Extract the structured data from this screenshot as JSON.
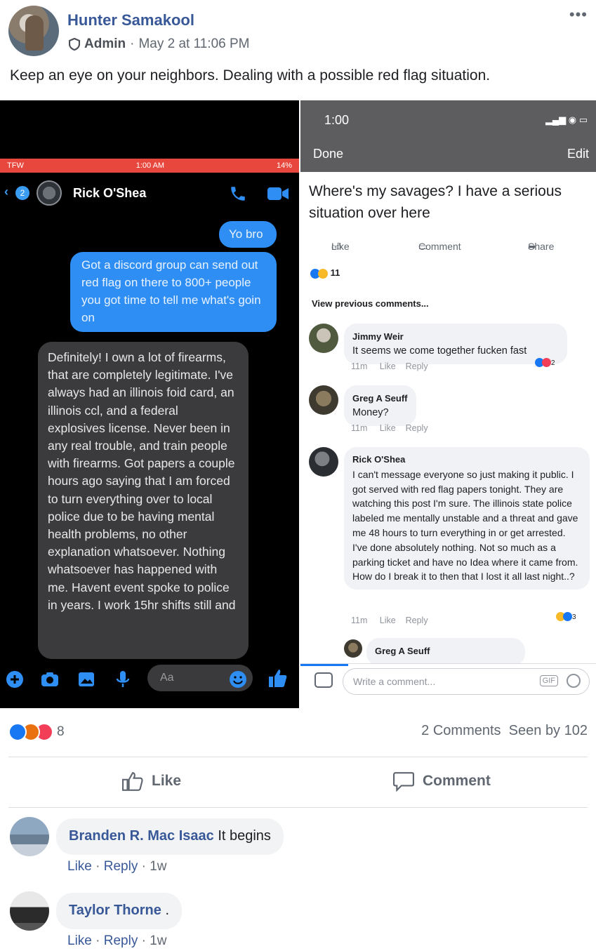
{
  "post": {
    "author": "Hunter Samakool",
    "role": "Admin",
    "separator": "·",
    "timestamp": "May 2 at 11:06 PM",
    "more": "•••",
    "text": "Keep an eye on your neighbors. Dealing with a possible red flag situation."
  },
  "left_screenshot": {
    "status": {
      "carrier": "TFW",
      "time": "1:00 AM",
      "battery": "14%"
    },
    "back_count": "2",
    "contact_name": "Rick O'Shea",
    "messages": [
      {
        "from": "me",
        "text": "Yo bro"
      },
      {
        "from": "me",
        "text": "Got a discord group can send out red flag on there to 800+ people you got time to tell me what's goin on"
      },
      {
        "from": "them",
        "text": "Definitely! I own a lot of firearms, that are completely legitimate. I've always had an illinois foid card, an illinois ccl, and a federal explosives license. Never been in any real trouble, and train people with firearms. Got papers a couple hours ago saying that I am forced to turn everything over to local police due to be having mental health problems, no other explanation whatsoever. Nothing whatsoever has happened with me. Havent event spoke to police in years. I work 15hr shifts still and"
      }
    ],
    "composer_placeholder": "Aa"
  },
  "right_screenshot": {
    "time": "1:00",
    "done": "Done",
    "edit": "Edit",
    "post_text": "Where's my savages? I have a serious situation over here",
    "actions": {
      "like": "Like",
      "comment": "Comment",
      "share": "Share"
    },
    "reaction_count": "11",
    "view_previous": "View previous comments...",
    "comments": [
      {
        "name": "Jimmy Weir",
        "text": "It seems we come together fucken fast",
        "time": "11m",
        "like": "Like",
        "reply": "Reply",
        "reacts": "2"
      },
      {
        "name": "Greg A Seuff",
        "text": "Money?",
        "time": "11m",
        "like": "Like",
        "reply": "Reply",
        "reacts": ""
      },
      {
        "name": "Rick O'Shea",
        "text": "I can't message everyone so just making it public. I got served with red flag papers tonight. They are watching this post I'm sure. The illinois state police labeled me mentally unstable and a threat and gave me 48 hours to turn everything in or get arrested. I've done absolutely nothing. Not so much as a parking ticket and have no Idea where it came from. How do I break it to then that I lost it all last night..?",
        "time": "11m",
        "like": "Like",
        "reply": "Reply",
        "reacts": "3"
      },
      {
        "name": "Greg A Seuff",
        "text": "",
        "time": "",
        "like": "",
        "reply": "",
        "reacts": ""
      }
    ],
    "write_placeholder": "Write a comment...",
    "gif": "GIF"
  },
  "footer": {
    "reaction_count": "8",
    "comments_count": "2 Comments",
    "seen_by": "Seen by 102",
    "like_label": "Like",
    "comment_label": "Comment"
  },
  "comments": [
    {
      "name": "Branden R. Mac Isaac",
      "text": "It begins",
      "like": "Like",
      "reply": "Reply",
      "time": "1w"
    },
    {
      "name": "Taylor Thorne",
      "text": ".",
      "like": "Like",
      "reply": "Reply",
      "time": "1w"
    }
  ],
  "colors": {
    "link_blue": "#385898",
    "messenger_blue": "#2f8ef3",
    "status_red": "#e8473d",
    "reaction_like": "#1877f2",
    "reaction_love": "#f33e58",
    "reaction_angry": "#e9710f"
  }
}
